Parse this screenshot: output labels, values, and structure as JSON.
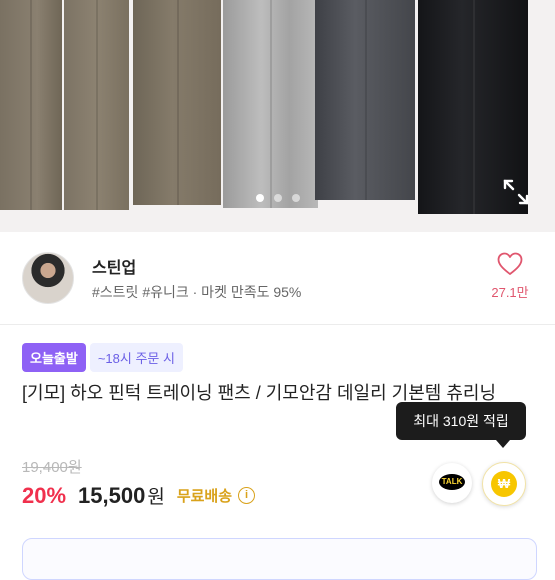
{
  "gallery": {
    "slide_count": 3,
    "active_index": 0,
    "expand_icon": "expand-arrows-icon"
  },
  "seller": {
    "name": "스틴업",
    "meta": "#스트릿 #유니크 · 마켓 만족도 95%",
    "like_icon": "heart-outline-icon",
    "like_count": "27.1만"
  },
  "product": {
    "badge_today": "오늘출발",
    "badge_time": "~18시 주문 시",
    "title": "[기모] 하오 핀턱 트레이닝 팬츠 / 기모안감 데일리 기본템 츄리닝",
    "points_tooltip": "최대 310원 적립",
    "original_price": "19,400원",
    "discount": "20%",
    "price": "15,500",
    "currency": "원",
    "shipping": "무료배송",
    "talk_label": "TALK",
    "point_symbol": "₩"
  },
  "colors": {
    "accent_purple": "#8e61f5",
    "discount_red": "#f0304d",
    "like_pink": "#e0566e",
    "shipping_gold": "#d9a21b"
  }
}
